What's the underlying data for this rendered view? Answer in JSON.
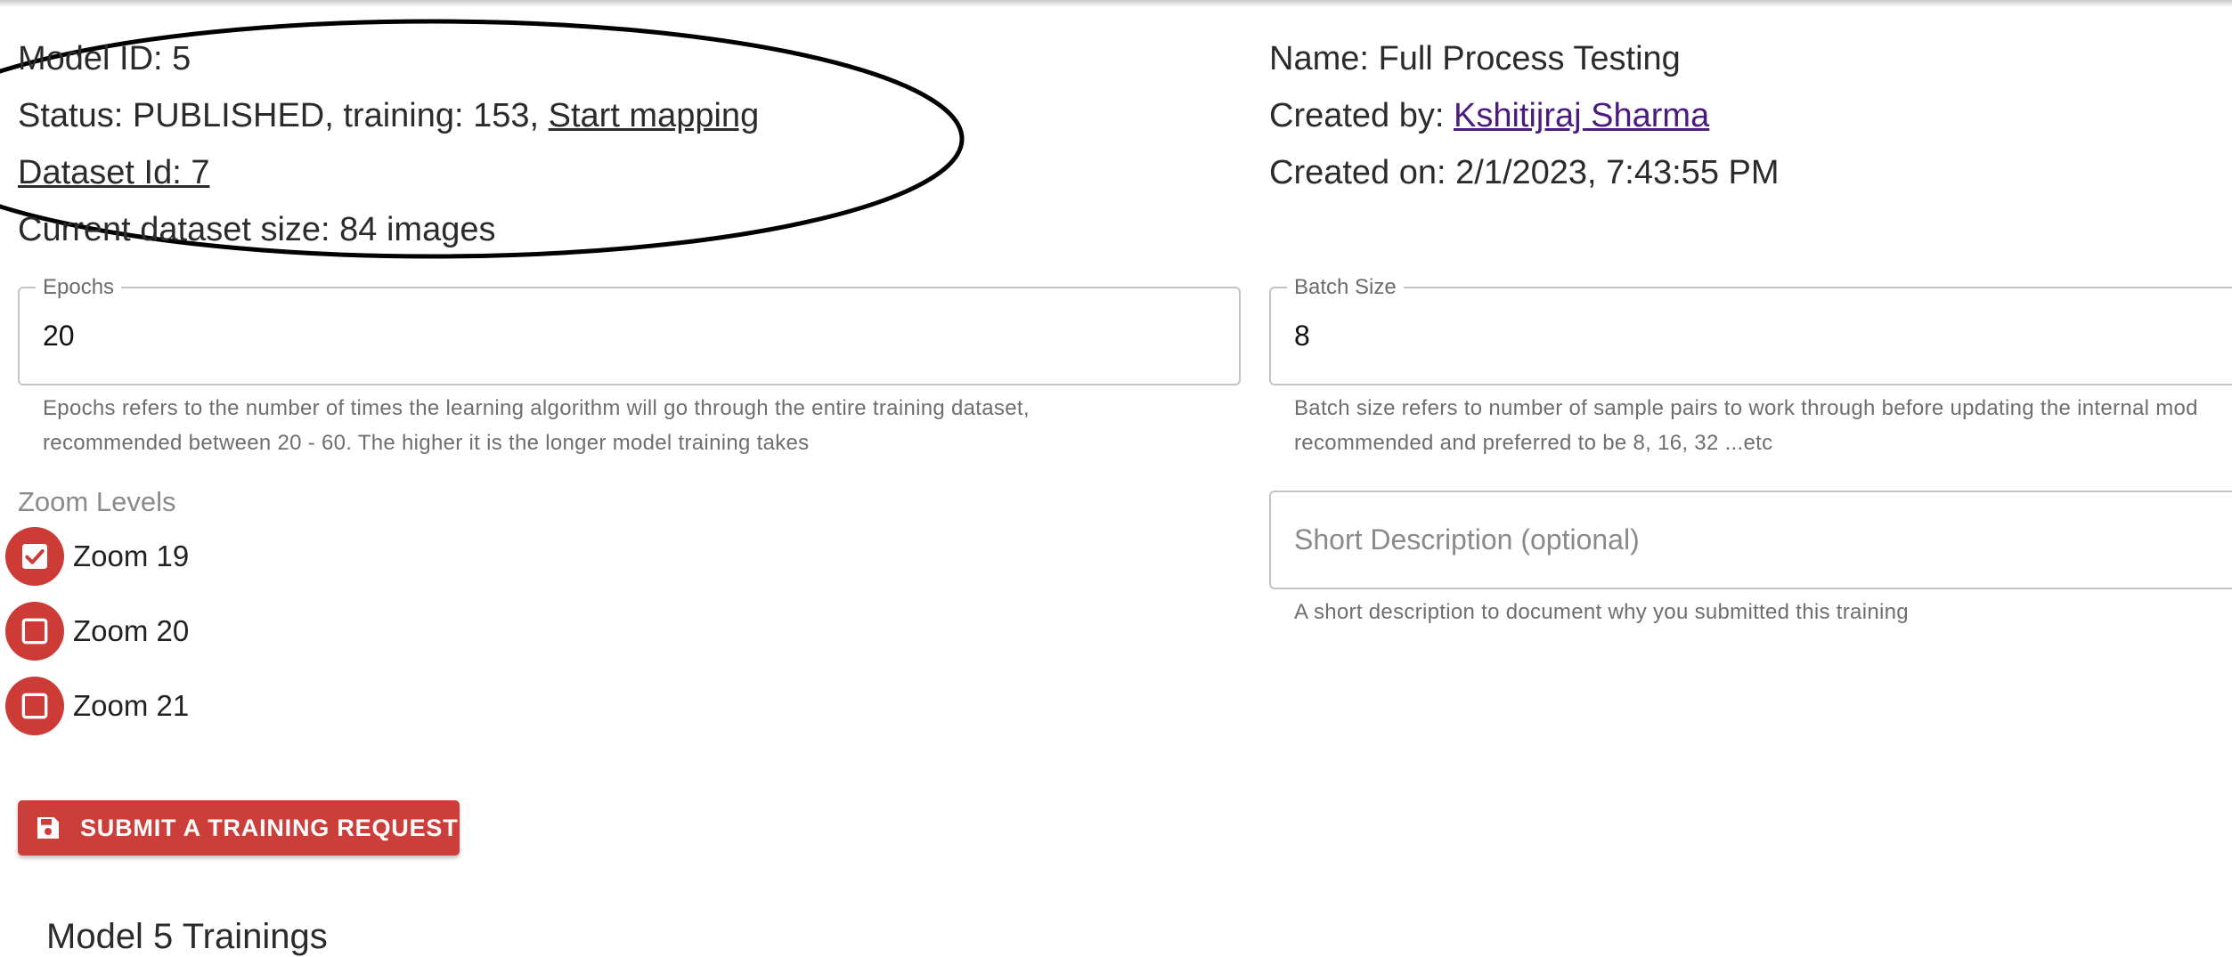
{
  "model": {
    "id_text": "Model ID: 5",
    "status_text": "Status: PUBLISHED, training: 153, ",
    "start_mapping_link": "Start mapping",
    "dataset_link": "Dataset Id: 7",
    "dataset_size_text": "Current dataset size: 84 images",
    "name_text": "Name: Full Process Testing",
    "created_by_prefix": "Created by: ",
    "created_by_link": "Kshitijraj Sharma",
    "created_on_text": "Created on: 2/1/2023, 7:43:55 PM"
  },
  "epochs": {
    "label": "Epochs",
    "value": "20",
    "helper_line1": "Epochs refers to the number of times the learning algorithm will go through the entire training dataset,",
    "helper_line2": "recommended between 20 - 60. The higher it is the longer model training takes"
  },
  "batch_size": {
    "label": "Batch Size",
    "value": "8",
    "helper_line1": "Batch size refers to number of sample pairs to work through before updating the internal mod",
    "helper_line2": "recommended and preferred to be 8, 16, 32 ...etc"
  },
  "description": {
    "placeholder": "Short Description (optional)",
    "helper": "A short description to document why you submitted this training"
  },
  "zoom": {
    "title": "Zoom Levels",
    "levels": [
      {
        "label": "Zoom 19",
        "checked": true
      },
      {
        "label": "Zoom 20",
        "checked": false
      },
      {
        "label": "Zoom 21",
        "checked": false
      }
    ]
  },
  "submit_label": "SUBMIT A TRAINING REQUEST",
  "trainings_title": "Model 5 Trainings",
  "icons": {
    "submit": "save-icon",
    "checkbox_checked": "checkbox-checked-icon",
    "checkbox_unchecked": "checkbox-unchecked-icon"
  },
  "colors": {
    "accent": "#cc3e3a",
    "visited_link": "#4a1c7e",
    "text": "#2b2b2b",
    "helper_text": "#6e6e6e"
  }
}
